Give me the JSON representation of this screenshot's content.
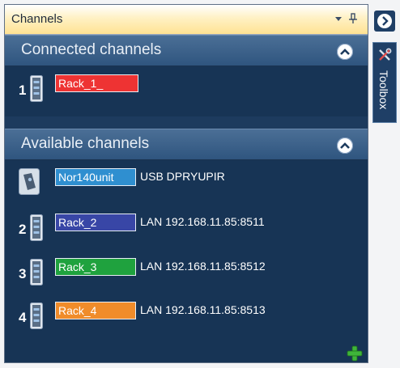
{
  "panel": {
    "title": "Channels",
    "connected": {
      "title": "Connected channels",
      "channels": [
        {
          "index": "1",
          "name": "Rack_1_",
          "color": "#ee3333",
          "connection": ""
        }
      ]
    },
    "available": {
      "title": "Available channels",
      "channels": [
        {
          "index": "",
          "name": "Nor140unit",
          "color": "#2f8fd0",
          "connection": "USB DPRYUPIR",
          "icon": "device-icon"
        },
        {
          "index": "2",
          "name": "Rack_2",
          "color": "#3846a6",
          "connection": "LAN 192.168.11.85:8511",
          "icon": "rack-icon"
        },
        {
          "index": "3",
          "name": "Rack_3",
          "color": "#1fa23e",
          "connection": "LAN 192.168.11.85:8512",
          "icon": "rack-icon"
        },
        {
          "index": "4",
          "name": "Rack_4",
          "color": "#f08c2a",
          "connection": "LAN 192.168.11.85:8513",
          "icon": "rack-icon"
        }
      ]
    }
  },
  "toolbox": {
    "label": "Toolbox"
  },
  "icons": {
    "pin": "pin-icon",
    "dropdown": "dropdown-icon",
    "collapse": "chevron-up-icon",
    "add": "plus-icon",
    "expand": "chevron-right-icon",
    "toolbox": "tools-icon"
  }
}
